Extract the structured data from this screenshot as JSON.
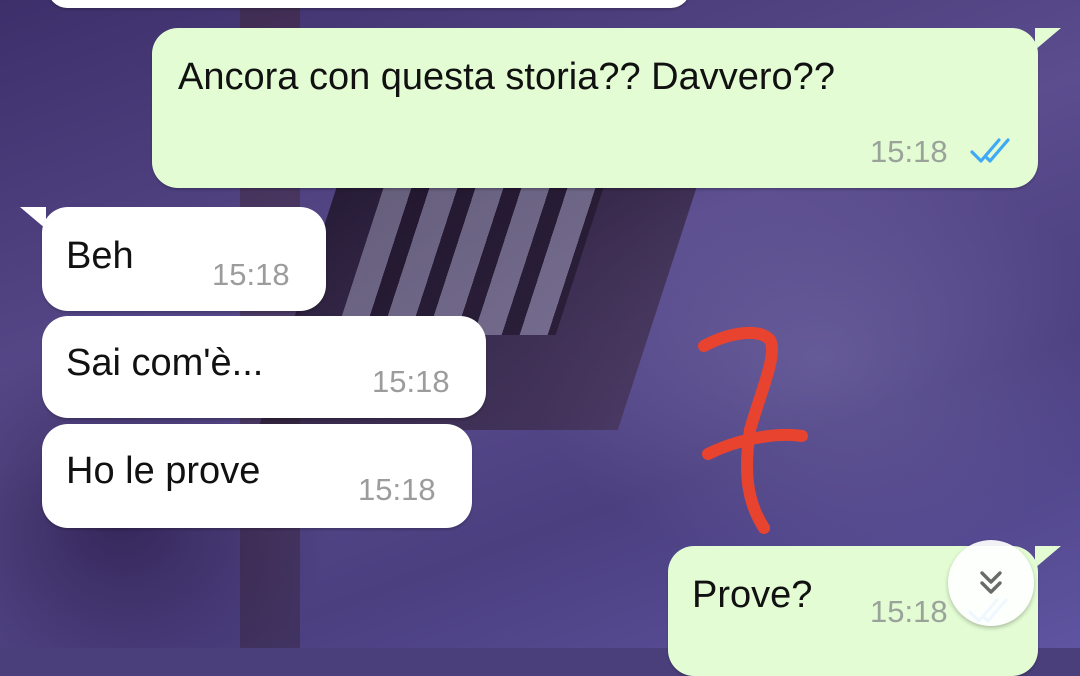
{
  "chat": {
    "messages": [
      {
        "direction": "out",
        "text": "Ancora con questa storia?? Davvero??",
        "time": "15:18",
        "status": "read"
      },
      {
        "direction": "in",
        "text": "Beh",
        "time": "15:18"
      },
      {
        "direction": "in",
        "text": "Sai com'è...",
        "time": "15:18"
      },
      {
        "direction": "in",
        "text": "Ho le prove",
        "time": "15:18"
      },
      {
        "direction": "out",
        "text": "Prove?",
        "time": "15:18",
        "status": "read"
      }
    ]
  },
  "annotation": {
    "text": "7",
    "color": "#e8432f"
  },
  "scroll_button": {
    "icon": "double-chevron-down-icon"
  },
  "colors": {
    "outgoing_bubble": "#e3fcd4",
    "incoming_bubble": "#ffffff",
    "read_ticks": "#3fa9f5"
  }
}
